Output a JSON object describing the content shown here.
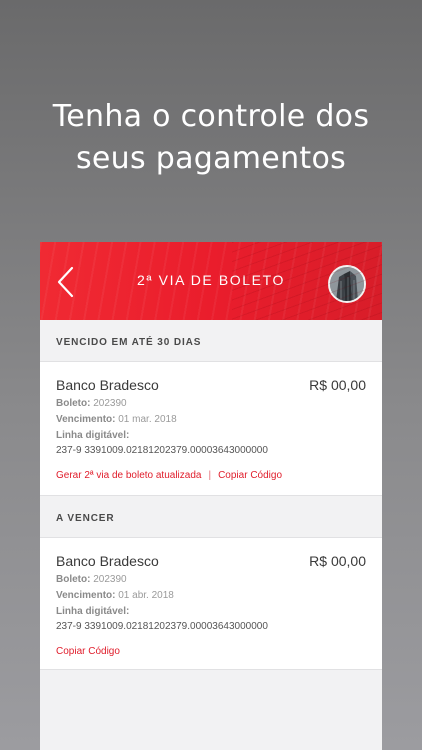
{
  "hero": {
    "line1": "Tenha o controle dos",
    "line2": "seus pagamentos"
  },
  "appbar": {
    "title": "2ª VIA DE BOLETO",
    "back_icon": "chevron-left-icon",
    "avatar_icon": "building-photo",
    "accent_color": "#ea1d2c"
  },
  "sections": [
    {
      "header": "VENCIDO EM ATÉ 30 DIAS",
      "item": {
        "bank": "Banco Bradesco",
        "amount": "R$ 00,00",
        "boleto_label": "Boleto:",
        "boleto_value": "202390",
        "vencimento_label": "Vencimento:",
        "vencimento_value": "01 mar. 2018",
        "linha_label": "Linha digitável:",
        "linha_value": "237-9 3391009.02181202379.00003643000000",
        "action_generate": "Gerar 2ª via de boleto atualizada",
        "action_separator": "|",
        "action_copy": "Copiar Código"
      }
    },
    {
      "header": "A VENCER",
      "item": {
        "bank": "Banco Bradesco",
        "amount": "R$ 00,00",
        "boleto_label": "Boleto:",
        "boleto_value": "202390",
        "vencimento_label": "Vencimento:",
        "vencimento_value": "01 abr. 2018",
        "linha_label": "Linha digitável:",
        "linha_value": "237-9 3391009.02181202379.00003643000000",
        "action_copy": "Copiar Código"
      }
    }
  ]
}
